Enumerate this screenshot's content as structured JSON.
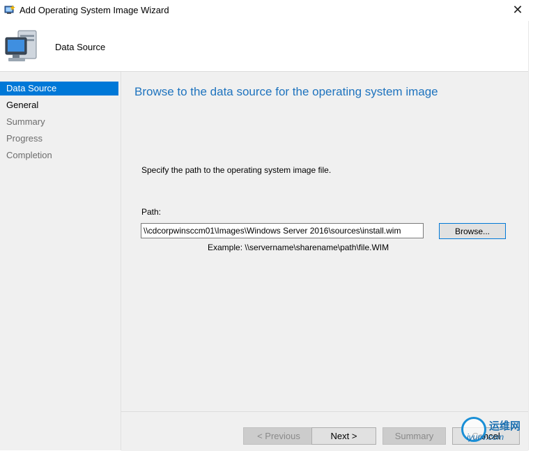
{
  "window": {
    "title": "Add Operating System Image Wizard",
    "close_glyph": "✕"
  },
  "header": {
    "title": "Data Source",
    "icon": "computer-icon"
  },
  "sidebar": {
    "items": [
      {
        "label": "Data Source",
        "state": "active"
      },
      {
        "label": "General",
        "state": "bold"
      },
      {
        "label": "Summary",
        "state": "dim"
      },
      {
        "label": "Progress",
        "state": "dim"
      },
      {
        "label": "Completion",
        "state": "dim"
      }
    ]
  },
  "content": {
    "heading": "Browse to the data source for the operating system image",
    "instruction": "Specify the path to the operating system image file.",
    "path_label": "Path:",
    "path_value": "\\\\cdcorpwinsccm01\\Images\\Windows Server 2016\\sources\\install.wim",
    "browse_label": "Browse...",
    "example": "Example: \\\\servername\\sharename\\path\\file.WIM"
  },
  "footer": {
    "previous_label": "< Previous",
    "next_label": "Next >",
    "summary_label": "Summary",
    "cancel_label": "Cancel"
  },
  "watermark": {
    "text1": "运维网",
    "text2": "iyunv.com"
  },
  "colors": {
    "accent": "#0078d7",
    "heading": "#1e73be",
    "panel": "#f0f0f0"
  }
}
